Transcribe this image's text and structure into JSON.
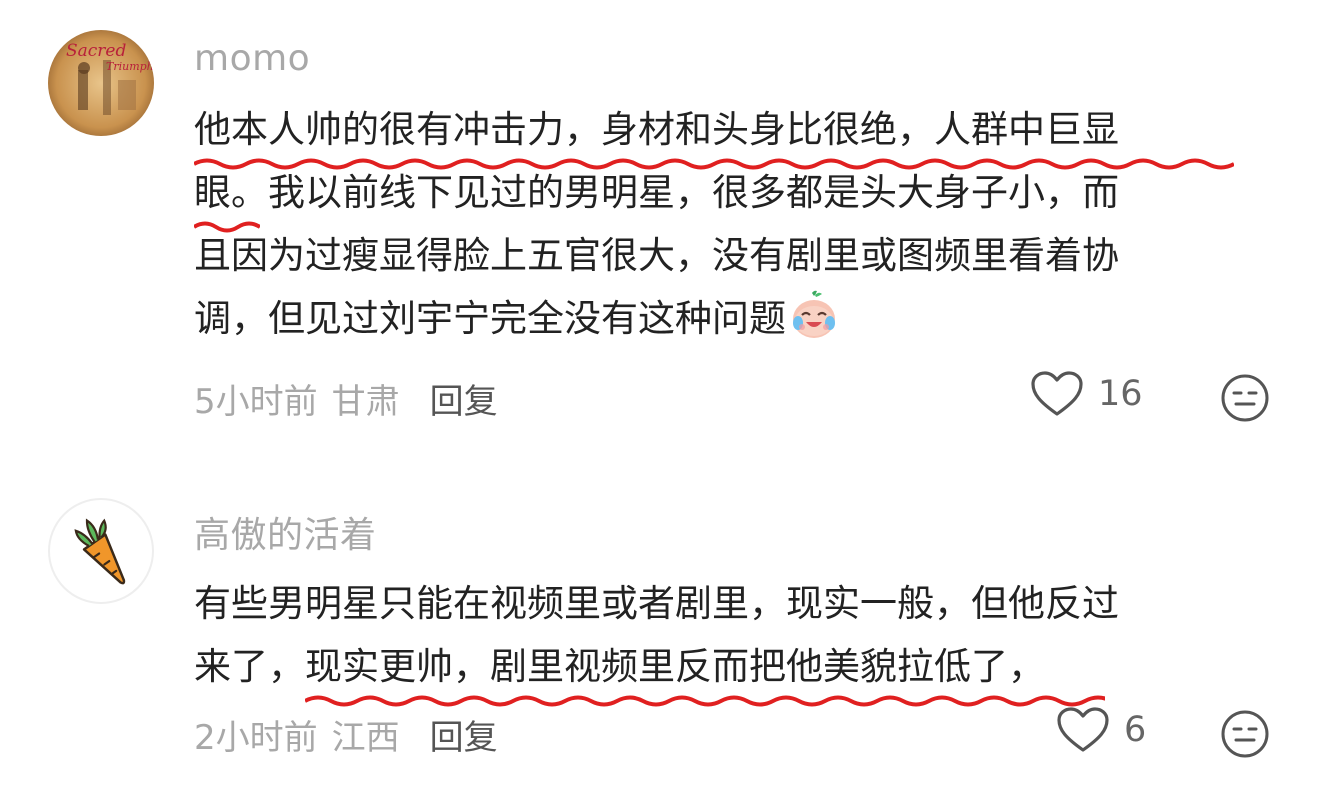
{
  "comments": [
    {
      "username": "momo",
      "avatar_icon": "sacred-triumph-avatar",
      "avatar_text": [
        "Sacred",
        "Triumph"
      ],
      "lines": [
        "他本人帅的很有冲击力，身材和头身比很绝，人群中巨显",
        "眼",
        "。我以前线下见过的男明星，很多都是头大身子小，而",
        "且因为过瘦显得脸上五官很大，没有剧里或图频里看着协",
        "调，但见过刘宇宁完全没有这种问题"
      ],
      "emoji": "crying-laughing-peach-emoji",
      "time": "5小时前",
      "location": "甘肃",
      "reply_label": "回复",
      "like_count": "16"
    },
    {
      "username": "高傲的活着",
      "avatar_icon": "carrot-avatar",
      "lines": [
        "有些男明星只能在视频里或者剧里，现实一般，但他反过",
        "来了，",
        "现实更帅，剧里视频里反而把他美貌拉低了，"
      ],
      "time": "2小时前",
      "location": "江西",
      "reply_label": "回复",
      "like_count": "6"
    }
  ],
  "colors": {
    "username": "#a8a8a8",
    "text": "#222222",
    "wavy_underline": "#e02020",
    "meta": "#a8a8a8",
    "icon": "#666666"
  }
}
